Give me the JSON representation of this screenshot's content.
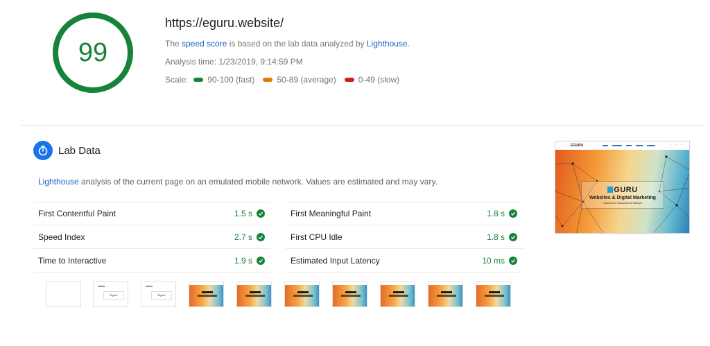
{
  "score": {
    "value": "99",
    "fraction": 0.99,
    "color": "#178239"
  },
  "header": {
    "url": "https://eguru.website/",
    "desc_prefix": "The ",
    "desc_link1": "speed score",
    "desc_middle": " is based on the lab data analyzed by ",
    "desc_link2": "Lighthouse",
    "desc_suffix": ".",
    "analysis_time": "Analysis time: 1/23/2019, 9:14:59 PM",
    "scale_label": "Scale:",
    "scale": [
      {
        "label": "90-100 (fast)",
        "color": "#178239"
      },
      {
        "label": "50-89 (average)",
        "color": "#e67700"
      },
      {
        "label": "0-49 (slow)",
        "color": "#c7221f"
      }
    ]
  },
  "lab": {
    "icon": "stopwatch-icon",
    "title": "Lab Data",
    "desc_link": "Lighthouse",
    "desc_text": " analysis of the current page on an emulated mobile network. Values are estimated and may vary.",
    "metrics_left": [
      {
        "label": "First Contentful Paint",
        "value": "1.5 s"
      },
      {
        "label": "Speed Index",
        "value": "2.7 s"
      },
      {
        "label": "Time to Interactive",
        "value": "1.9 s"
      }
    ],
    "metrics_right": [
      {
        "label": "First Meaningful Paint",
        "value": "1.8 s"
      },
      {
        "label": "First CPU Idle",
        "value": "1.8 s"
      },
      {
        "label": "Estimated Input Latency",
        "value": "10 ms"
      }
    ],
    "status_color": "#178239"
  },
  "screenshot": {
    "nav_logo": "EGURU",
    "logo": "GURU",
    "headline": "Websites & Digital Marketing",
    "tagline": "Solutions for Businesses & Startups",
    "frame_card_text": "Eguru",
    "frames": [
      "blank",
      "text",
      "text",
      "loaded",
      "loaded",
      "loaded",
      "loaded",
      "loaded",
      "loaded",
      "loaded"
    ]
  }
}
